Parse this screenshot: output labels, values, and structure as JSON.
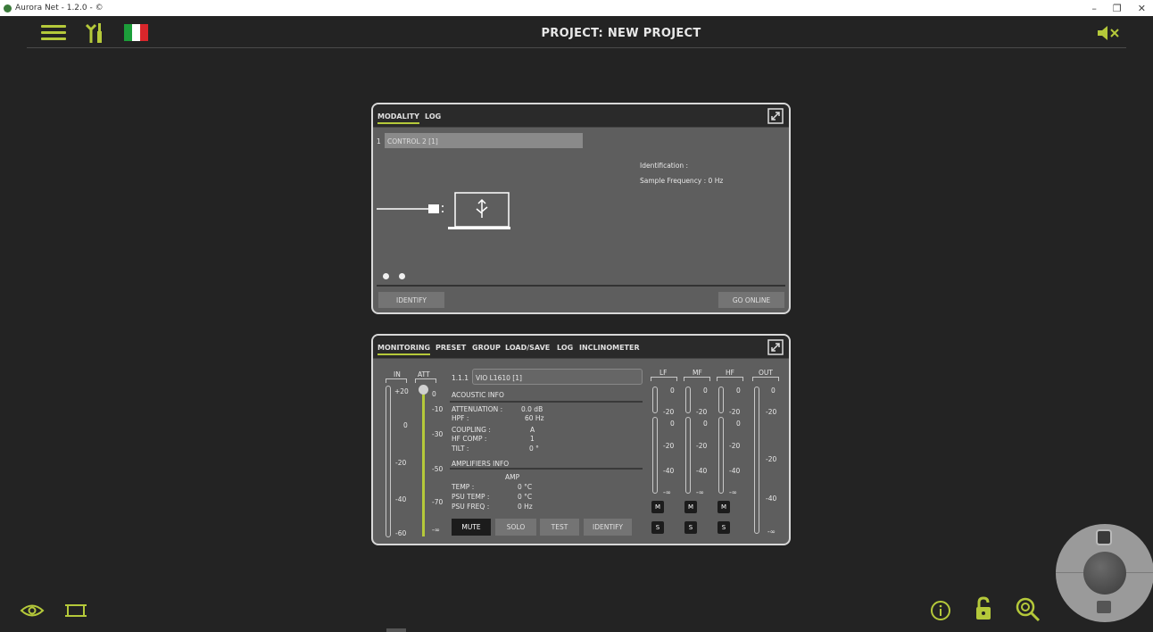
{
  "window": {
    "title": "Aurora Net - 1.2.0 - ©",
    "controls": [
      "–",
      "❐",
      "✕"
    ]
  },
  "header": {
    "project_title": "PROJECT: NEW PROJECT",
    "icons": [
      "menu-icon",
      "tools-icon",
      "language-flag-italy-icon",
      "speaker-mute-icon"
    ]
  },
  "colors": {
    "accent": "#b5c93a",
    "panel": "#5e5e5e",
    "background": "#232323"
  },
  "modality_panel": {
    "tabs": [
      "MODALITY",
      "LOG"
    ],
    "device_index": "1",
    "device_name": "CONTROL 2 [1]",
    "identification": "Identification :",
    "sample_frequency": "Sample Frequency : 0 Hz",
    "connection_icon": "usb-laptop-icon",
    "identify_button": "IDENTIFY",
    "go_online_button": "GO ONLINE"
  },
  "monitoring_panel": {
    "tabs": [
      "MONITORING",
      "PRESET",
      "GROUP",
      "LOAD/SAVE",
      "LOG",
      "INCLINOMETER"
    ],
    "in_label": "IN",
    "att_label": "ATT",
    "in_scale": [
      "+20",
      "0",
      "-20",
      "-40",
      "-60"
    ],
    "att_scale": [
      "0",
      "-10",
      "-30",
      "-50",
      "-70",
      "-∞"
    ],
    "device_index": "1.1.1",
    "device_name": "VIO L1610 [1]",
    "acoustic_info_title": "ACOUSTIC INFO",
    "acoustic_info": [
      {
        "label": "ATTENUATION :",
        "value": "0.0 dB"
      },
      {
        "label": "HPF :",
        "value": "60 Hz"
      },
      {
        "label": "COUPLING :",
        "value": "A"
      },
      {
        "label": "HF COMP :",
        "value": "1"
      },
      {
        "label": "TILT :",
        "value": "0 °"
      }
    ],
    "amplifiers_info_title": "AMPLIFIERS INFO",
    "amp_header": "AMP",
    "amp_info": [
      {
        "label": "TEMP :",
        "value": "0 °C"
      },
      {
        "label": "PSU TEMP :",
        "value": "0 °C"
      },
      {
        "label": "PSU FREQ :",
        "value": "0 Hz"
      }
    ],
    "buttons": {
      "mute": "MUTE",
      "solo": "SOLO",
      "test": "TEST",
      "identify": "IDENTIFY"
    },
    "band_labels": [
      "LF",
      "MF",
      "HF",
      "OUT"
    ],
    "band_scale_top": [
      "0",
      "-20"
    ],
    "band_scale_bottom": [
      "0",
      "-20",
      "-40",
      "-∞"
    ],
    "out_scale": [
      "0",
      "-20",
      "-20",
      "-40",
      "-∞"
    ],
    "m_label": "M",
    "s_label": "S"
  },
  "footer_icons": [
    "eye-icon",
    "fit-screen-icon",
    "info-icon",
    "unlock-icon",
    "zoom-icon",
    "joystick-control"
  ]
}
